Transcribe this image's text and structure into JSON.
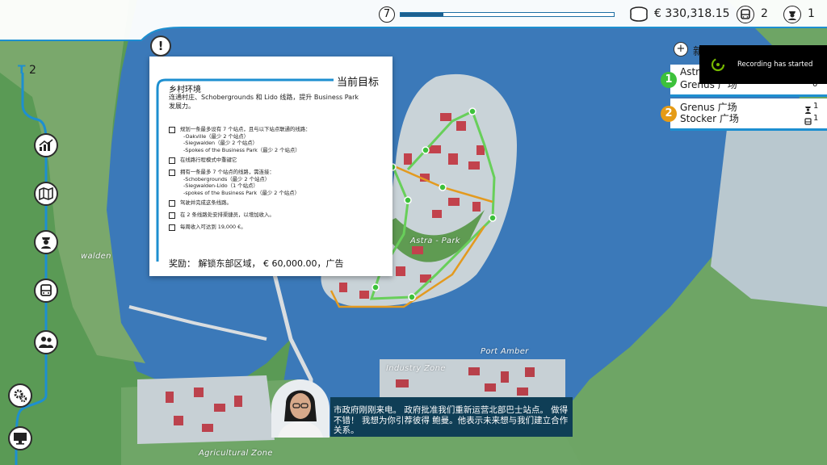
{
  "topbar": {
    "level": "7",
    "progress": 0.2,
    "money": "€ 330,318.15",
    "buses": "2",
    "drivers": "1"
  },
  "left_rail": {
    "line_count": "2",
    "buttons": [
      "chart-icon",
      "map-icon",
      "driver-icon",
      "bus-icon",
      "people-icon",
      "gears-icon",
      "monitor-icon"
    ]
  },
  "objectives": {
    "header": "当前目标",
    "title": "乡村环境",
    "description": "连通村庄、Schobergrounds 和 Lido 线路，提升 Business Park 发展力。",
    "tasks": [
      {
        "lines": [
          "规划一条最多设有 7 个站点，且与以下站点联通的线路：",
          "-Oakville（最少 2 个站点）",
          "-Siegwalden（最少 2 个站点）",
          "-Spokes of the Business Park（最少 2 个站点）"
        ]
      },
      {
        "lines": [
          "在线路行程模式中重键它"
        ]
      },
      {
        "lines": [
          "拥有一条最多 7 个站点的线路，需连接：",
          "-Schobergrounds（最少 2 个站点）",
          "-Siegwalden-Lido（1 个站点）",
          "-spokes of the Business Park（最少 2 个站点）"
        ]
      },
      {
        "lines": [
          "驾驶并完成这条线路。"
        ]
      },
      {
        "lines": [
          "在 2 条线路处安排渠捷员，以增加收入。"
        ]
      },
      {
        "lines": [
          "每周收入可达到 19,000 €。"
        ]
      }
    ],
    "reward": "奖励： 解锁东部区域， € 60,000.00，广告"
  },
  "lines_panel": {
    "add_label": "新",
    "items": [
      {
        "number": "1",
        "color": "#3cc13b",
        "names": [
          "Astra",
          "Grenus 广场"
        ],
        "count1": "",
        "count2": "0"
      },
      {
        "number": "2",
        "color": "#e59b16",
        "names": [
          "Grenus 广场",
          "Stocker 广场"
        ],
        "count1": "1",
        "count2": "1"
      }
    ]
  },
  "recording": {
    "text": "Recording has started"
  },
  "dialog": {
    "text": "市政府刚刚来电。 政府批准我们重新运营北部巴士站点。 做得不错！ 我想为你引荐彼得 鲍曼。他表示未来想与我们建立合作关系。"
  },
  "map_labels": {
    "astra_park": "Astra - Park",
    "industry_zone": "Industry Zone",
    "port_amber": "Port Amber",
    "agricultural_zone": "Agricultural Zone",
    "walden": "walden"
  }
}
